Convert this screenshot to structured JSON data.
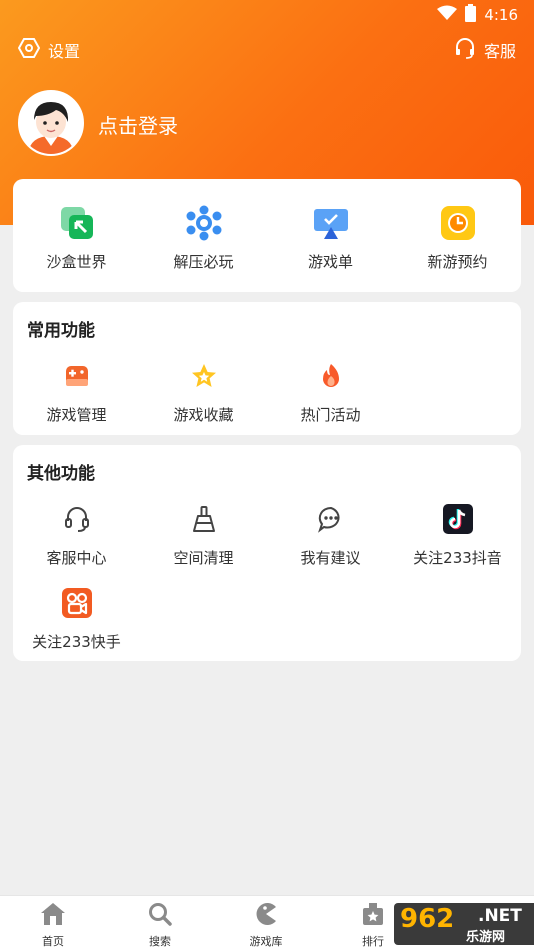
{
  "status": {
    "time": "4:16"
  },
  "top": {
    "settings_label": "设置",
    "service_label": "客服"
  },
  "user": {
    "login_label": "点击登录"
  },
  "quick": [
    {
      "label": "沙盒世界",
      "icon": "sandbox-icon"
    },
    {
      "label": "解压必玩",
      "icon": "decompress-icon"
    },
    {
      "label": "游戏单",
      "icon": "game-list-icon"
    },
    {
      "label": "新游预约",
      "icon": "reservation-clock-icon"
    }
  ],
  "common": {
    "title": "常用功能",
    "items": [
      {
        "label": "游戏管理",
        "icon": "gamepad-icon"
      },
      {
        "label": "游戏收藏",
        "icon": "star-icon"
      },
      {
        "label": "热门活动",
        "icon": "fire-icon"
      }
    ]
  },
  "other": {
    "title": "其他功能",
    "items": [
      {
        "label": "客服中心",
        "icon": "headset-icon"
      },
      {
        "label": "空间清理",
        "icon": "broom-icon"
      },
      {
        "label": "我有建议",
        "icon": "chat-bubble-icon"
      },
      {
        "label": "关注233抖音",
        "icon": "douyin-icon"
      },
      {
        "label": "关注233快手",
        "icon": "kuaishou-icon"
      }
    ]
  },
  "nav": [
    {
      "label": "首页",
      "icon": "home-icon"
    },
    {
      "label": "搜索",
      "icon": "search-icon"
    },
    {
      "label": "游戏库",
      "icon": "game-library-icon"
    },
    {
      "label": "排行",
      "icon": "ranking-icon"
    }
  ],
  "watermark": {
    "number": "962",
    "net": ".NET",
    "site": "乐游网"
  },
  "colors": {
    "accent": "#fb6f12",
    "background": "#efefef"
  }
}
